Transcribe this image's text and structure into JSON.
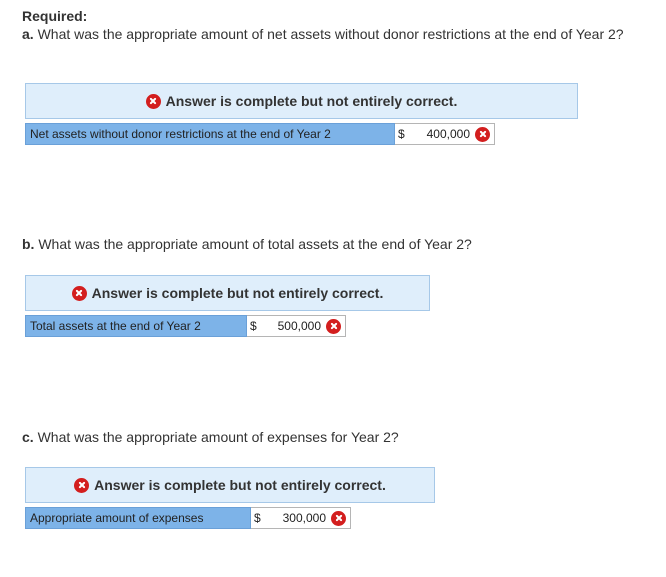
{
  "required_label": "Required:",
  "status_text": "Answer is complete but not entirely correct.",
  "questions": [
    {
      "letter": "a.",
      "text": "What was the appropriate amount of net assets without donor restrictions at the end of Year 2?",
      "answer_label": "Net assets without donor restrictions at the end of Year 2",
      "currency": "$",
      "value": "400,000"
    },
    {
      "letter": "b.",
      "text": "What was the appropriate amount of total assets at the end of Year 2?",
      "answer_label": "Total assets at the end of Year 2",
      "currency": "$",
      "value": "500,000"
    },
    {
      "letter": "c.",
      "text": "What was the appropriate amount of expenses for Year 2?",
      "answer_label": "Appropriate amount of expenses",
      "currency": "$",
      "value": "300,000"
    }
  ],
  "icons": {
    "status": "error-x-icon",
    "field": "incorrect-x-icon"
  },
  "colors": {
    "status_background": "#dfeefb",
    "label_background": "#7db3e8",
    "error": "#d31e1e"
  }
}
